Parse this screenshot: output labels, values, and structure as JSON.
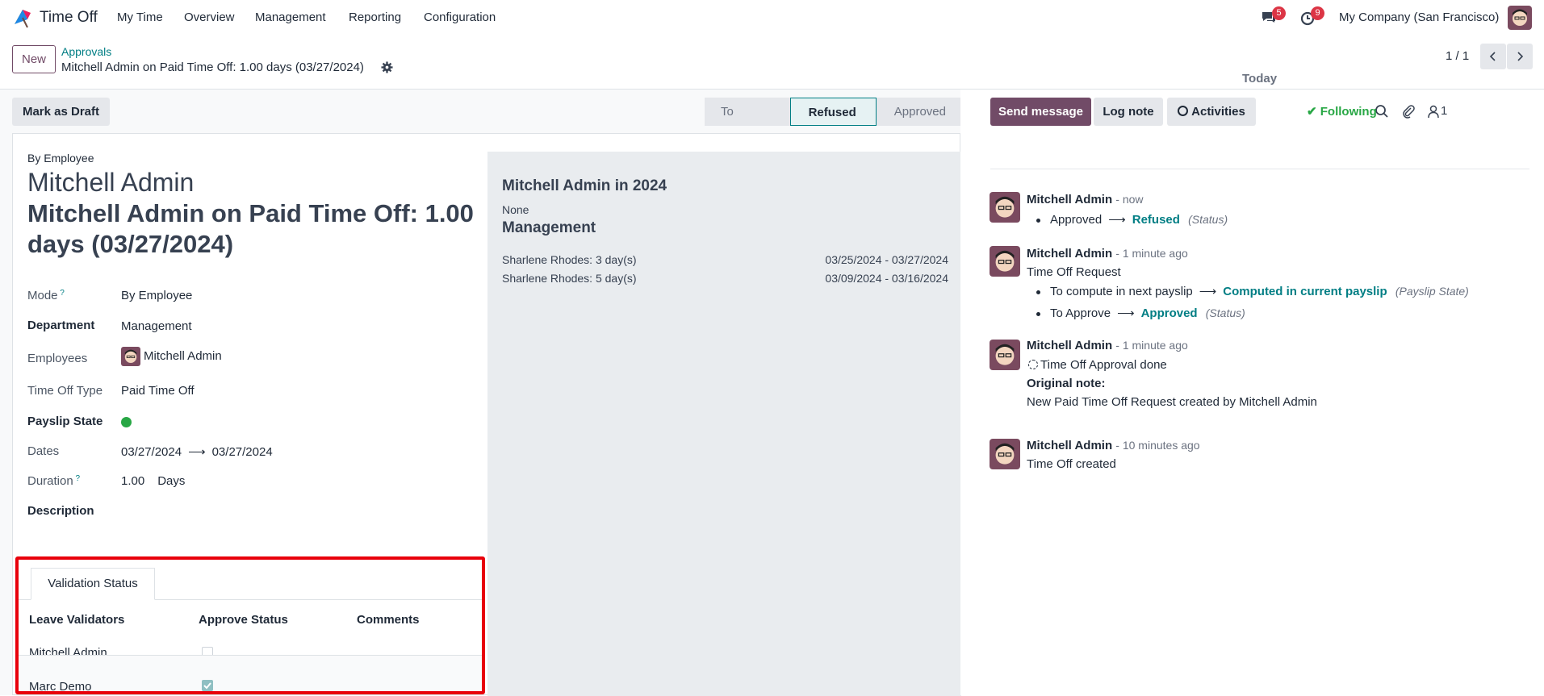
{
  "topbar": {
    "app_name": "Time Off",
    "menu": [
      "My Time",
      "Overview",
      "Management",
      "Reporting",
      "Configuration"
    ],
    "chat_badge": "5",
    "activity_badge": "9",
    "company": "My Company (San Francisco)"
  },
  "control_panel": {
    "new_label": "New",
    "breadcrumb_parent": "Approvals",
    "record_title": "Mitchell Admin on Paid Time Off: 1.00 days (03/27/2024)",
    "pager": "1 / 1"
  },
  "statusbar": {
    "draft_label": "Mark as Draft",
    "stages": [
      "To Approve",
      "Refused",
      "Approved"
    ],
    "active_stage": "Refused"
  },
  "form": {
    "mode_caption": "By Employee",
    "employee_name": "Mitchell Admin",
    "leave_name": "Mitchell Admin on Paid Time Off: 1.00 days (03/27/2024)",
    "fields": {
      "mode_label": "Mode",
      "mode_value": "By Employee",
      "department_label": "Department",
      "department_value": "Management",
      "employees_label": "Employees",
      "employees_value": "Mitchell Admin",
      "type_label": "Time Off Type",
      "type_value": "Paid Time Off",
      "payslip_label": "Payslip State",
      "payslip_color": "#28a745",
      "dates_label": "Dates",
      "date_from": "03/27/2024",
      "date_to": "03/27/2024",
      "duration_label": "Duration",
      "duration_value": "1.00",
      "duration_unit": "Days",
      "description_label": "Description"
    },
    "validation": {
      "tab_label": "Validation Status",
      "headers": [
        "Leave Validators",
        "Approve Status",
        "Comments"
      ],
      "rows": [
        {
          "validator": "Mitchell Admin",
          "approved": false,
          "comment": ""
        },
        {
          "validator": "Marc Demo",
          "approved": true,
          "comment": ""
        }
      ]
    },
    "side": {
      "title": "Mitchell Admin in 2024",
      "none_label": "None",
      "department": "Management",
      "rows": [
        {
          "name": "Sharlene Rhodes: 3 day(s)",
          "dates": "03/25/2024 - 03/27/2024"
        },
        {
          "name": "Sharlene Rhodes: 5 day(s)",
          "dates": "03/09/2024 - 03/16/2024"
        }
      ]
    }
  },
  "chatter": {
    "send_label": "Send message",
    "log_label": "Log note",
    "activities_label": "Activities",
    "followers_count": "1",
    "following_label": "Following",
    "date_separator": "Today",
    "messages": [
      {
        "author": "Mitchell Admin",
        "when": "- now",
        "old": "Approved",
        "new": "Refused",
        "field": "(Status)"
      },
      {
        "author": "Mitchell Admin",
        "when": "- 1 minute ago",
        "body": "Time Off Request",
        "c1_old": "To compute in next payslip",
        "c1_new": "Computed in current payslip",
        "c1_field": "(Payslip State)",
        "c2_old": "To Approve",
        "c2_new": "Approved",
        "c2_field": "(Status)"
      },
      {
        "author": "Mitchell Admin",
        "when": "- 1 minute ago",
        "activity": "Time Off Approval done",
        "note_label": "Original note:",
        "note": "New Paid Time Off Request created by Mitchell Admin"
      },
      {
        "author": "Mitchell Admin",
        "when": "- 10 minutes ago",
        "body": "Time Off created"
      }
    ]
  }
}
